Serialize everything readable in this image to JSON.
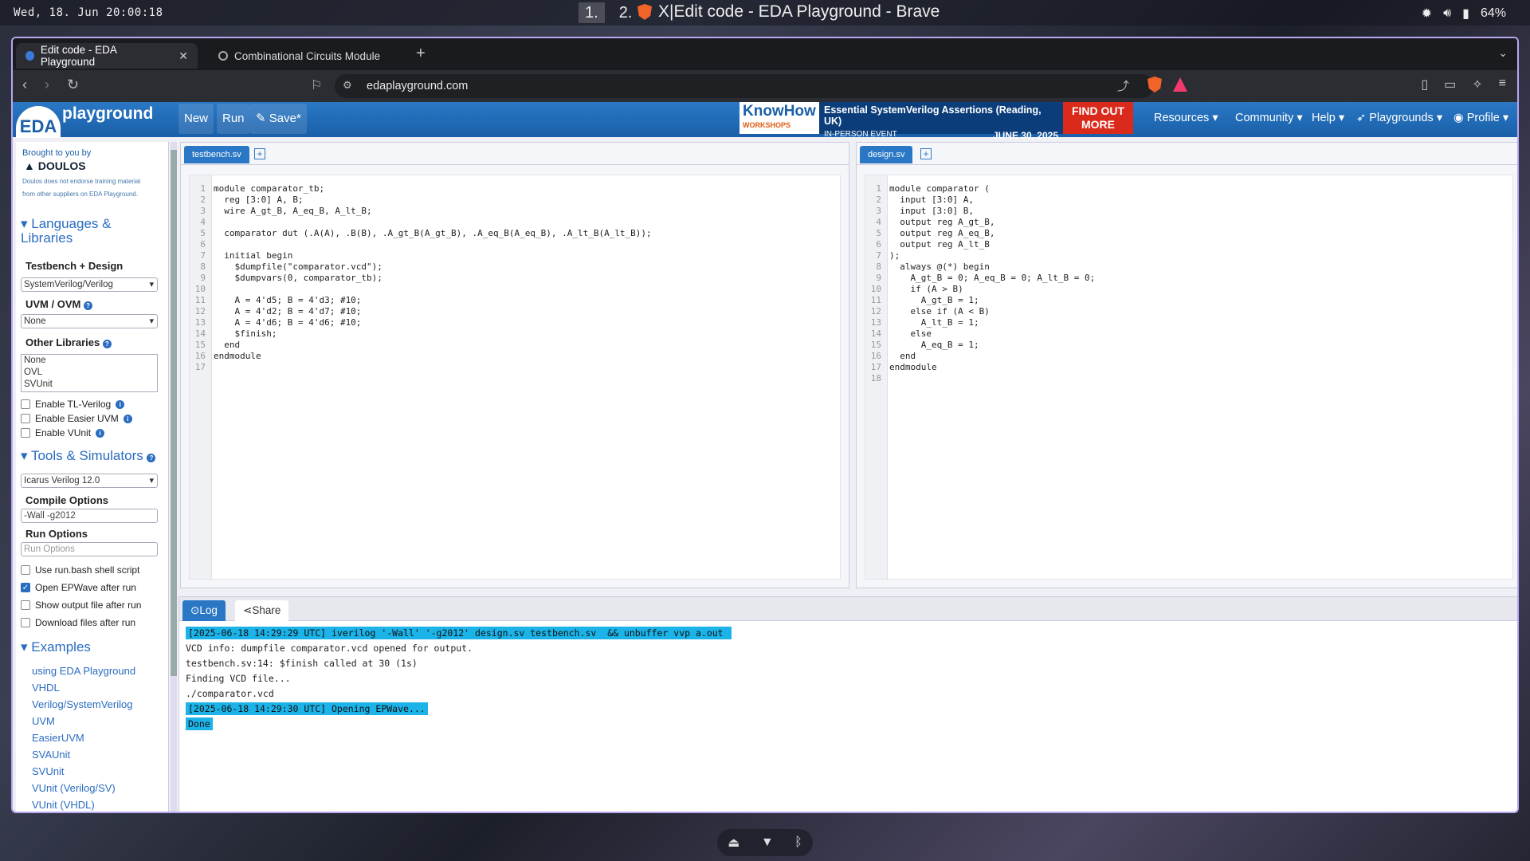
{
  "system": {
    "clock": "Wed, 18. Jun  20:00:18",
    "workspaces": [
      "1.",
      "2."
    ],
    "window_title": "X|Edit code - EDA Playground - Brave",
    "battery": "64%"
  },
  "browser": {
    "tabs": [
      {
        "label": "Edit code - EDA Playground"
      },
      {
        "label": "Combinational Circuits Module"
      }
    ],
    "url": "edaplayground.com"
  },
  "navbar": {
    "logo_eda": "EDA",
    "logo_text": "playground",
    "new_label": "New",
    "run_label": "Run",
    "save_label": "Save*",
    "ad": {
      "brand": "KnowHow",
      "brand_sub": "WORKSHOPS",
      "title": "Essential SystemVerilog Assertions (Reading, UK)",
      "event": "IN-PERSON EVENT",
      "date": "JUNE 30, 2025",
      "cta": "FIND OUT MORE"
    },
    "resources": "Resources ▾",
    "community": "Community ▾",
    "help": "Help ▾",
    "playgrounds": "Playgrounds ▾",
    "profile": "Profile ▾"
  },
  "sidebar": {
    "brought_by": "Brought to you by",
    "sponsor": "DOULOS",
    "sponsor_note": "Doulos does not endorse training material from other suppliers on EDA Playground.",
    "languages_heading": "Languages & Libraries",
    "testbench_design_label": "Testbench + Design",
    "testbench_design_value": "SystemVerilog/Verilog",
    "uvm_label": "UVM / OVM",
    "uvm_value": "None",
    "other_libs_label": "Other Libraries",
    "other_libs": [
      "None",
      "OVL",
      "SVUnit"
    ],
    "enable_tl": "Enable TL-Verilog",
    "enable_easier": "Enable Easier UVM",
    "enable_vunit": "Enable VUnit",
    "tools_heading": "Tools & Simulators",
    "simulator_value": "Icarus Verilog 12.0",
    "compile_label": "Compile Options",
    "compile_value": "-Wall -g2012",
    "run_label": "Run Options",
    "run_placeholder": "Run Options",
    "use_runbash": "Use run.bash shell script",
    "open_epwave": "Open EPWave after run",
    "show_output": "Show output file after run",
    "download_files": "Download files after run",
    "examples_heading": "Examples",
    "examples": [
      "using EDA Playground",
      "VHDL",
      "Verilog/SystemVerilog",
      "UVM",
      "EasierUVM",
      "SVAUnit",
      "SVUnit",
      "VUnit (Verilog/SV)",
      "VUnit (VHDL)"
    ]
  },
  "testbench": {
    "tab": "testbench.sv",
    "lines": [
      "module comparator_tb;",
      "  reg [3:0] A, B;",
      "  wire A_gt_B, A_eq_B, A_lt_B;",
      "",
      "  comparator dut (.A(A), .B(B), .A_gt_B(A_gt_B), .A_eq_B(A_eq_B), .A_lt_B(A_lt_B));",
      "",
      "  initial begin",
      "    $dumpfile(\"comparator.vcd\");",
      "    $dumpvars(0, comparator_tb);",
      "",
      "    A = 4'd5; B = 4'd3; #10;",
      "    A = 4'd2; B = 4'd7; #10;",
      "    A = 4'd6; B = 4'd6; #10;",
      "    $finish;",
      "  end",
      "endmodule",
      ""
    ]
  },
  "design": {
    "tab": "design.sv",
    "lines": [
      "module comparator (",
      "  input [3:0] A,",
      "  input [3:0] B,",
      "  output reg A_gt_B,",
      "  output reg A_eq_B,",
      "  output reg A_lt_B",
      ");",
      "  always @(*) begin",
      "    A_gt_B = 0; A_eq_B = 0; A_lt_B = 0;",
      "    if (A > B)",
      "      A_gt_B = 1;",
      "    else if (A < B)",
      "      A_lt_B = 1;",
      "    else",
      "      A_eq_B = 1;",
      "  end",
      "endmodule",
      ""
    ]
  },
  "console": {
    "log_tab": "Log",
    "share_tab": "Share",
    "lines": [
      {
        "text": "[2025-06-18 14:29:29 UTC] iverilog '-Wall' '-g2012' design.sv testbench.sv  && unbuffer vvp a.out ",
        "hl": true
      },
      {
        "text": "VCD info: dumpfile comparator.vcd opened for output.",
        "hl": false
      },
      {
        "text": "testbench.sv:14: $finish called at 30 (1s)",
        "hl": false
      },
      {
        "text": "Finding VCD file...",
        "hl": false
      },
      {
        "text": "./comparator.vcd",
        "hl": false
      },
      {
        "text": "[2025-06-18 14:29:30 UTC] Opening EPWave...",
        "hl": true
      },
      {
        "text": "Done",
        "hl": true
      }
    ]
  }
}
